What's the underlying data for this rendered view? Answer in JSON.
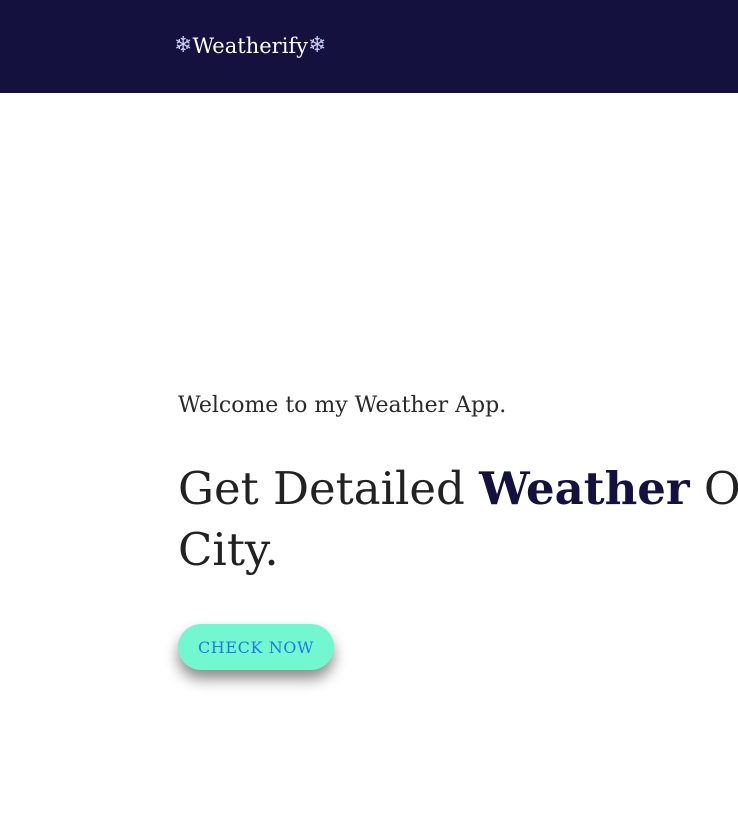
{
  "navbar": {
    "brand": {
      "text": "Weatherify",
      "icon_left": "snowflake-icon",
      "icon_right": "snowflake-icon",
      "icon_glyph": "❄"
    }
  },
  "hero": {
    "welcome": "Welcome to my Weather App.",
    "headline_prefix": "Get Detailed ",
    "headline_emphasis": "Weather",
    "headline_suffix": " Of City.",
    "cta_label": "CHECK NOW"
  },
  "colors": {
    "navbar_bg": "#14113f",
    "accent": "#72f7d0",
    "cta_text": "#1f7be0",
    "emphasis": "#14113f"
  }
}
